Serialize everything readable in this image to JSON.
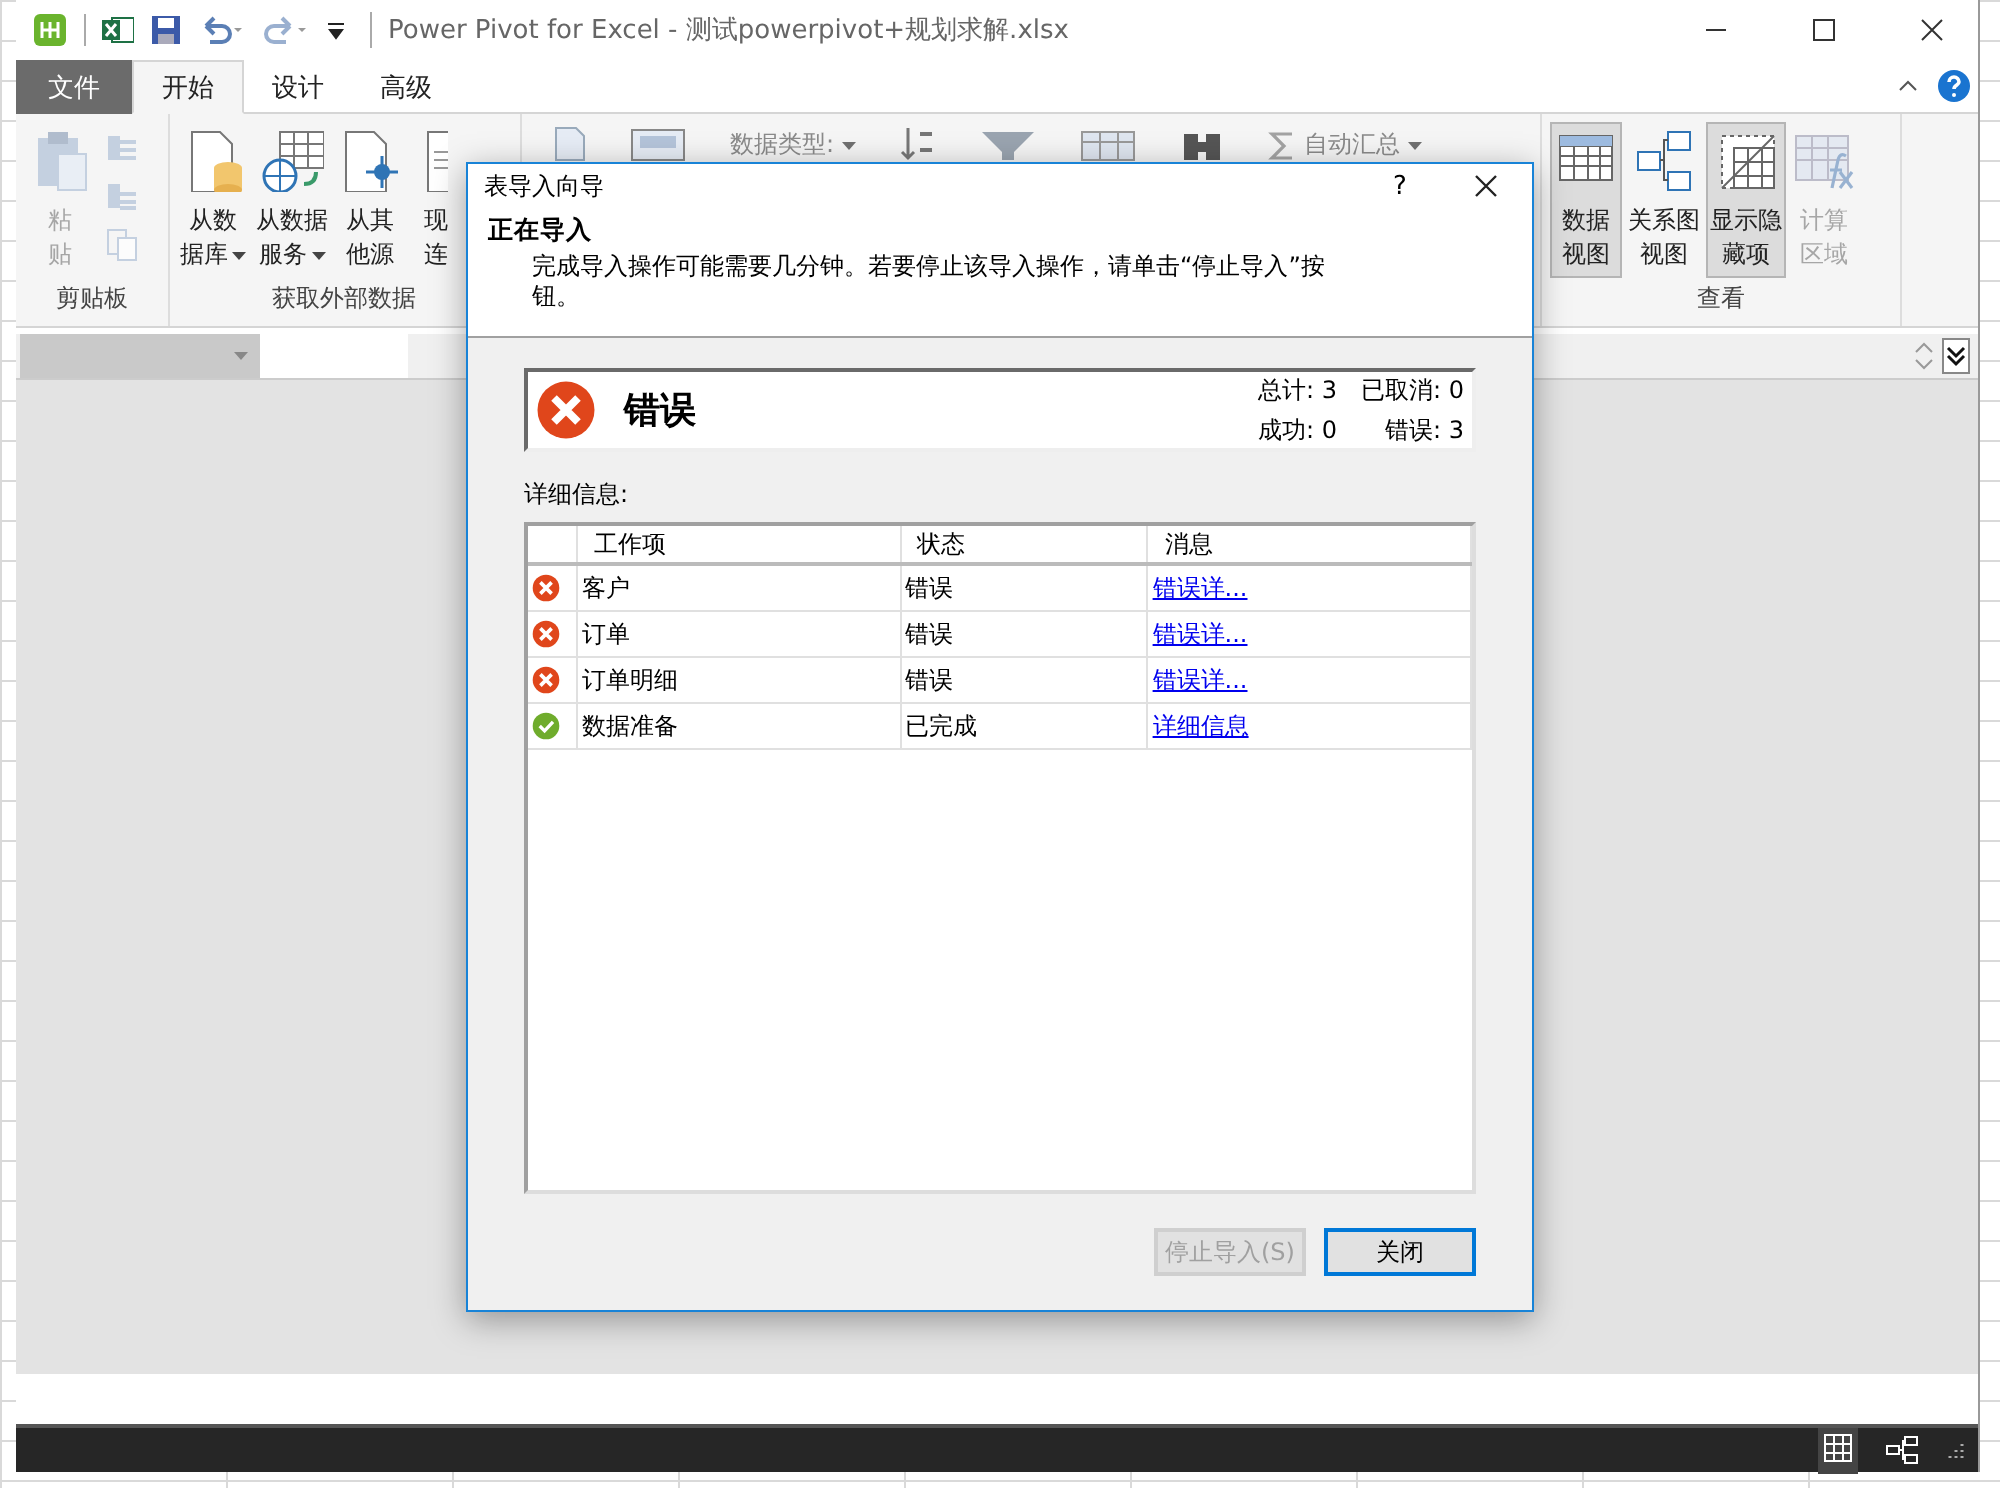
{
  "window": {
    "title": "Power Pivot for Excel - 测试powerpivot+规划求解.xlsx"
  },
  "tabs": [
    {
      "label": "文件",
      "kind": "file",
      "selected": false
    },
    {
      "label": "开始",
      "kind": "tab",
      "selected": true
    },
    {
      "label": "设计",
      "kind": "tab",
      "selected": false
    },
    {
      "label": "高级",
      "kind": "tab",
      "selected": false
    }
  ],
  "ribbon": {
    "groups": [
      {
        "label": "剪贴板",
        "items": [
          {
            "kind": "big",
            "lines": [
              "粘",
              "贴"
            ],
            "disabled": true
          },
          {
            "kind": "smallstack",
            "disabled": true
          }
        ]
      },
      {
        "label": "获取外部数据",
        "items": [
          {
            "kind": "big",
            "lines": [
              "从数",
              "据库"
            ],
            "dropdown": true,
            "disabled": false
          },
          {
            "kind": "big",
            "lines": [
              "从数据",
              "服务"
            ],
            "dropdown": true,
            "disabled": false
          },
          {
            "kind": "big",
            "lines": [
              "从其",
              "他源"
            ],
            "disabled": false
          },
          {
            "kind": "partial",
            "lines": [
              "现",
              "连"
            ],
            "disabled": false
          }
        ]
      },
      {
        "items": [
          {
            "kind": "icon"
          },
          {
            "kind": "icon"
          },
          {
            "kind": "text",
            "label": "数据类型:",
            "dropdown": true,
            "disabled": true
          },
          {
            "kind": "icon"
          },
          {
            "kind": "icon"
          },
          {
            "kind": "icon"
          },
          {
            "kind": "icon"
          },
          {
            "kind": "text",
            "label": "自动汇总",
            "dropdown": true,
            "disabled": true
          }
        ]
      },
      {
        "label": "查看",
        "items": [
          {
            "kind": "big",
            "lines": [
              "数据",
              "视图"
            ],
            "pressed": true,
            "disabled": false
          },
          {
            "kind": "big",
            "lines": [
              "关系图",
              "视图"
            ],
            "pressed": false,
            "disabled": false
          },
          {
            "kind": "big",
            "lines": [
              "显示隐",
              "藏项"
            ],
            "pressed": true,
            "disabled": false
          },
          {
            "kind": "big",
            "lines": [
              "计算",
              "区域"
            ],
            "pressed": false,
            "disabled": true
          }
        ]
      }
    ]
  },
  "dialog": {
    "title": "表导入向导",
    "help": "?",
    "heading": "正在导入",
    "description": "完成导入操作可能需要几分钟。若要停止该导入操作，请单击“停止导入”按钮。",
    "result": {
      "kind": "error",
      "label": "错误",
      "counts": [
        "总计: 3",
        "已取消: 0",
        "成功: 0",
        "错误: 3"
      ]
    },
    "details_label": "详细信息:",
    "table": {
      "columns": [
        "工作项",
        "状态",
        "消息"
      ],
      "rows": [
        {
          "kind": "error",
          "item": "客户",
          "status": "错误",
          "message": "错误详..."
        },
        {
          "kind": "error",
          "item": "订单",
          "status": "错误",
          "message": "错误详..."
        },
        {
          "kind": "error",
          "item": "订单明细",
          "status": "错误",
          "message": "错误详..."
        },
        {
          "kind": "done",
          "item": "数据准备",
          "status": "已完成",
          "message": "详细信息"
        }
      ]
    },
    "buttons": [
      {
        "label": "停止导入(S)",
        "disabled": true,
        "default": false
      },
      {
        "label": "关闭",
        "disabled": false,
        "default": true
      }
    ]
  }
}
